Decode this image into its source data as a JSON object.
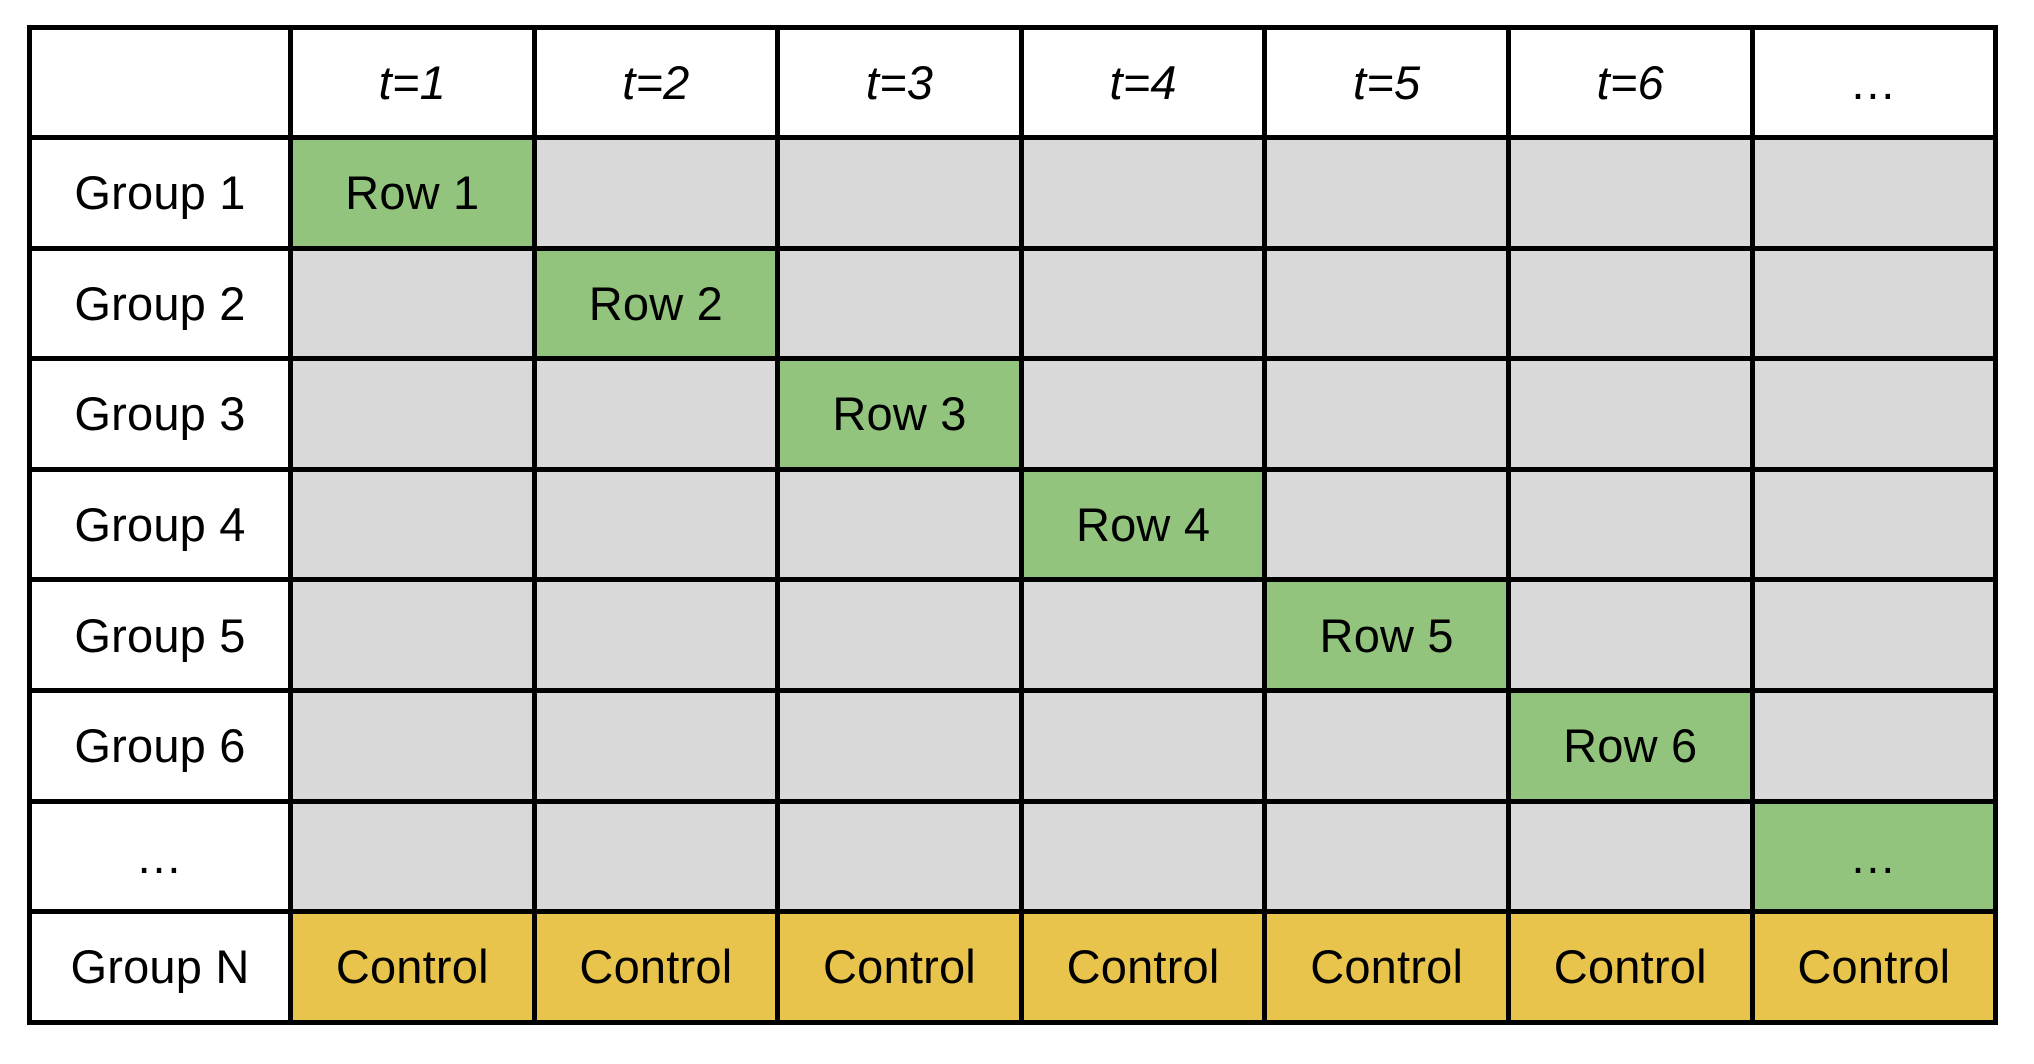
{
  "figure": {
    "kind": "staggered-adoption-design-matrix",
    "accent_colors": {
      "treated": "#93c47d",
      "control": "#e8c44d",
      "untreated": "#d9d9d9",
      "label_background": "#ffffff",
      "border": "#000000"
    }
  },
  "header": {
    "corner_label": "",
    "columns": [
      {
        "label": "t=1",
        "italic": true
      },
      {
        "label": "t=2",
        "italic": true
      },
      {
        "label": "t=3",
        "italic": true
      },
      {
        "label": "t=4",
        "italic": true
      },
      {
        "label": "t=5",
        "italic": true
      },
      {
        "label": "t=6",
        "italic": true
      },
      {
        "label": "…",
        "italic": false
      }
    ]
  },
  "rows": [
    {
      "label": "Group 1",
      "label_is_ellipsis": false,
      "cells": [
        {
          "text": "Row 1",
          "state": "treated"
        },
        {
          "text": "",
          "state": "empty"
        },
        {
          "text": "",
          "state": "empty"
        },
        {
          "text": "",
          "state": "empty"
        },
        {
          "text": "",
          "state": "empty"
        },
        {
          "text": "",
          "state": "empty"
        },
        {
          "text": "",
          "state": "empty"
        }
      ]
    },
    {
      "label": "Group 2",
      "label_is_ellipsis": false,
      "cells": [
        {
          "text": "",
          "state": "empty"
        },
        {
          "text": "Row 2",
          "state": "treated"
        },
        {
          "text": "",
          "state": "empty"
        },
        {
          "text": "",
          "state": "empty"
        },
        {
          "text": "",
          "state": "empty"
        },
        {
          "text": "",
          "state": "empty"
        },
        {
          "text": "",
          "state": "empty"
        }
      ]
    },
    {
      "label": "Group 3",
      "label_is_ellipsis": false,
      "cells": [
        {
          "text": "",
          "state": "empty"
        },
        {
          "text": "",
          "state": "empty"
        },
        {
          "text": "Row 3",
          "state": "treated"
        },
        {
          "text": "",
          "state": "empty"
        },
        {
          "text": "",
          "state": "empty"
        },
        {
          "text": "",
          "state": "empty"
        },
        {
          "text": "",
          "state": "empty"
        }
      ]
    },
    {
      "label": "Group 4",
      "label_is_ellipsis": false,
      "cells": [
        {
          "text": "",
          "state": "empty"
        },
        {
          "text": "",
          "state": "empty"
        },
        {
          "text": "",
          "state": "empty"
        },
        {
          "text": "Row 4",
          "state": "treated"
        },
        {
          "text": "",
          "state": "empty"
        },
        {
          "text": "",
          "state": "empty"
        },
        {
          "text": "",
          "state": "empty"
        }
      ]
    },
    {
      "label": "Group 5",
      "label_is_ellipsis": false,
      "cells": [
        {
          "text": "",
          "state": "empty"
        },
        {
          "text": "",
          "state": "empty"
        },
        {
          "text": "",
          "state": "empty"
        },
        {
          "text": "",
          "state": "empty"
        },
        {
          "text": "Row 5",
          "state": "treated"
        },
        {
          "text": "",
          "state": "empty"
        },
        {
          "text": "",
          "state": "empty"
        }
      ]
    },
    {
      "label": "Group 6",
      "label_is_ellipsis": false,
      "cells": [
        {
          "text": "",
          "state": "empty"
        },
        {
          "text": "",
          "state": "empty"
        },
        {
          "text": "",
          "state": "empty"
        },
        {
          "text": "",
          "state": "empty"
        },
        {
          "text": "",
          "state": "empty"
        },
        {
          "text": "Row 6",
          "state": "treated"
        },
        {
          "text": "",
          "state": "empty"
        }
      ]
    },
    {
      "label": "…",
      "label_is_ellipsis": true,
      "cells": [
        {
          "text": "",
          "state": "empty"
        },
        {
          "text": "",
          "state": "empty"
        },
        {
          "text": "",
          "state": "empty"
        },
        {
          "text": "",
          "state": "empty"
        },
        {
          "text": "",
          "state": "empty"
        },
        {
          "text": "",
          "state": "empty"
        },
        {
          "text": "…",
          "state": "treated"
        }
      ]
    },
    {
      "label": "Group N",
      "label_is_ellipsis": false,
      "cells": [
        {
          "text": "Control",
          "state": "control"
        },
        {
          "text": "Control",
          "state": "control"
        },
        {
          "text": "Control",
          "state": "control"
        },
        {
          "text": "Control",
          "state": "control"
        },
        {
          "text": "Control",
          "state": "control"
        },
        {
          "text": "Control",
          "state": "control"
        },
        {
          "text": "Control",
          "state": "control"
        }
      ]
    }
  ]
}
